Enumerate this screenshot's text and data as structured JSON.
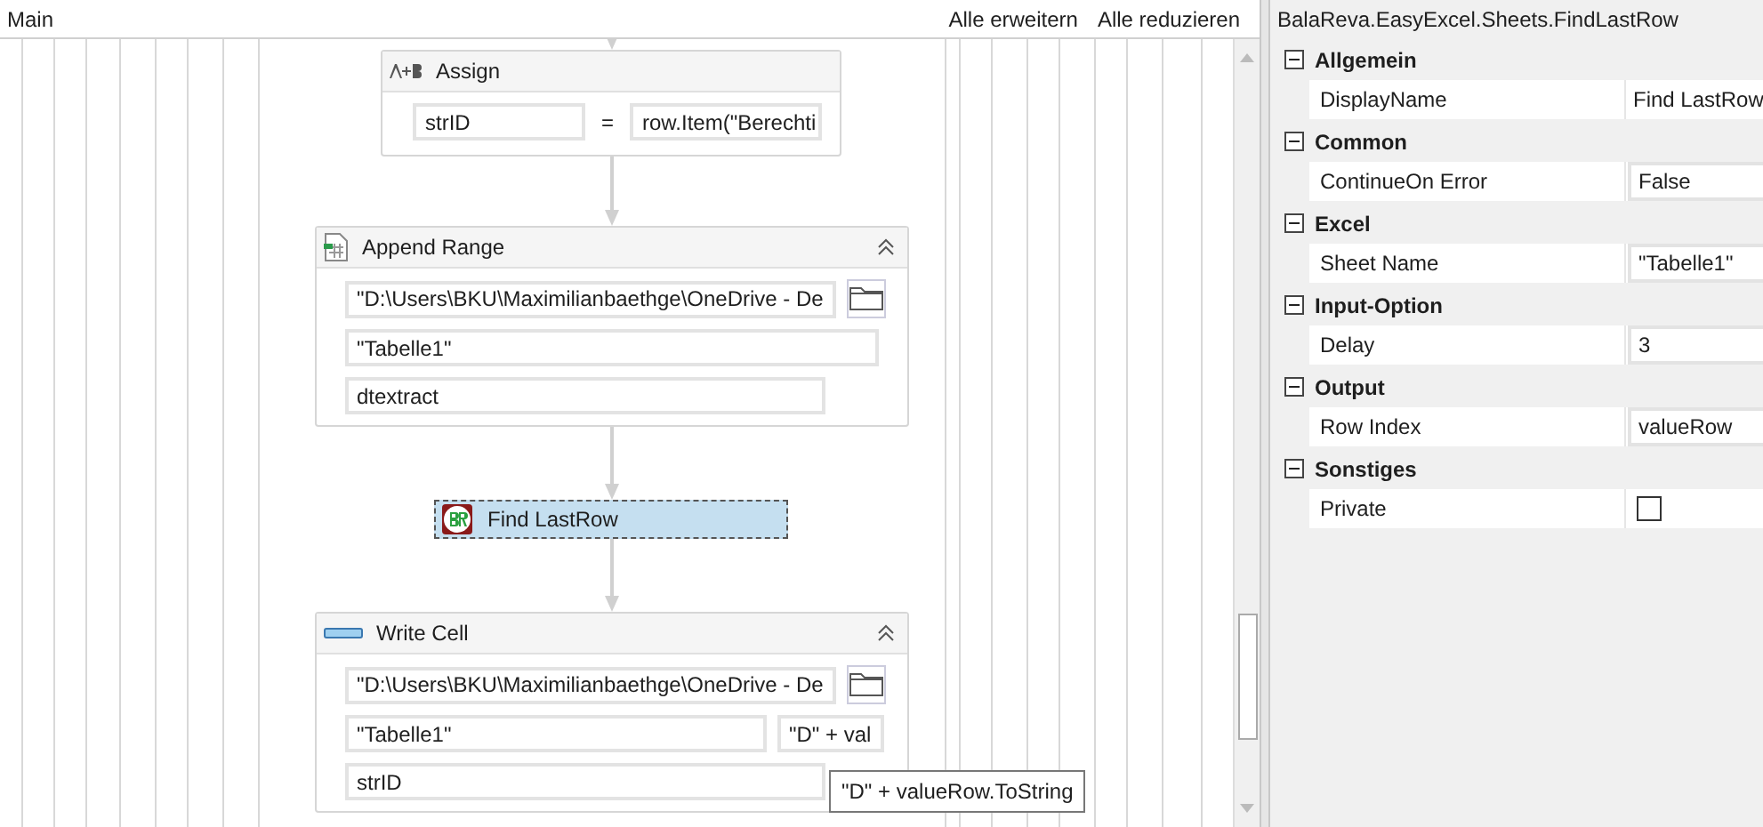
{
  "designer": {
    "title": "Main",
    "actions": [
      "Alle erweitern",
      "Alle reduzieren"
    ],
    "activities": [
      {
        "kind": "assign",
        "title": "Assign",
        "selected": false,
        "to": "strID",
        "operator": "=",
        "value": "row.Item(\"Berechti"
      },
      {
        "kind": "excel",
        "title": "Append Range",
        "selected": false,
        "rows": [
          [
            {
              "value": "\"D:\\Users\\BKU\\Maximilianbaethge\\OneDrive - De",
              "browse": true
            }
          ],
          [
            {
              "value": "\"Tabelle1\"",
              "browse": false
            }
          ],
          [
            {
              "value": "dtextract",
              "browse": false
            }
          ]
        ]
      },
      {
        "kind": "plain",
        "title": "Find LastRow",
        "selected": true
      },
      {
        "kind": "cell",
        "title": "Write Cell",
        "selected": false,
        "rows": [
          [
            {
              "value": "\"D:\\Users\\BKU\\Maximilianbaethge\\OneDrive - De",
              "browse": true
            }
          ],
          [
            {
              "value": "\"Tabelle1\"",
              "browse": false
            },
            {
              "value": "\"D\" + val",
              "browse": false
            }
          ],
          [
            {
              "value": "strID",
              "browse": false
            }
          ]
        ]
      }
    ],
    "tooltip": "\"D\" + valueRow.ToString"
  },
  "properties": {
    "title": "BalaReva.EasyExcel.Sheets.FindLastRow",
    "categories": [
      {
        "name": "Allgemein",
        "expanded": true,
        "items": [
          {
            "name": "DisplayName",
            "kind": "text",
            "value": "Find LastRow"
          }
        ]
      },
      {
        "name": "Common",
        "expanded": true,
        "items": [
          {
            "name": "ContinueOn Error",
            "kind": "field",
            "value": "False"
          }
        ]
      },
      {
        "name": "Excel",
        "expanded": true,
        "items": [
          {
            "name": "Sheet Name",
            "kind": "field",
            "value": "\"Tabelle1\""
          }
        ]
      },
      {
        "name": "Input-Option",
        "expanded": true,
        "items": [
          {
            "name": "Delay",
            "kind": "field",
            "value": "3"
          }
        ]
      },
      {
        "name": "Output",
        "expanded": true,
        "items": [
          {
            "name": "Row Index",
            "kind": "field",
            "value": "valueRow"
          }
        ]
      },
      {
        "name": "Sonstiges",
        "expanded": true,
        "items": [
          {
            "name": "Private",
            "kind": "checkbox",
            "checked": false
          }
        ]
      }
    ]
  }
}
